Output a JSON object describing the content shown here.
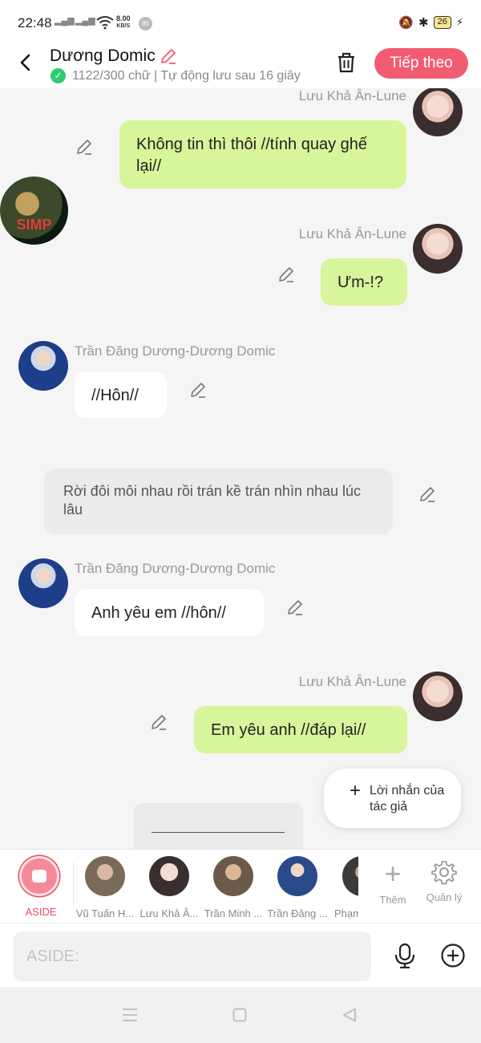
{
  "status_bar": {
    "time": "22:48",
    "net_speed_value": "8.00",
    "net_speed_unit": "KB/S",
    "notification_count": "95",
    "battery": "26"
  },
  "header": {
    "title": "Dương Domic",
    "subtitle": "1122/300 chữ | Tự động lưu sau 16 giây",
    "next_button_label": "Tiếp theo"
  },
  "messages": [
    {
      "sender": "Lưu Khả Ân-Lune",
      "text": "Không tin thì thôi //tính quay ghế lại//",
      "side": "right"
    },
    {
      "sender": "Lưu Khả Ân-Lune",
      "text": "Ưm-!?",
      "side": "right"
    },
    {
      "sender": "Trần Đăng Dương-Dương Domic",
      "text": "//Hôn//",
      "side": "left"
    },
    {
      "narration": "Rời đôi môi nhau rồi trán kề trán nhìn nhau lúc lâu"
    },
    {
      "sender": "Trần Đăng Dương-Dương Domic",
      "text": "Anh yêu em //hôn//",
      "side": "left"
    },
    {
      "sender": "Lưu Khả Ân-Lune",
      "text": "Em yêu anh //đáp lại//",
      "side": "right"
    }
  ],
  "simp_avatar_text": "SIMP",
  "author_note_label": "Lời nhắn của tác giả",
  "characters": {
    "aside_label": "ASIDE",
    "items": [
      {
        "name": "Vũ Tuấn H...",
        "color": "#7a6a5a"
      },
      {
        "name": "Lưu Khả Â...",
        "color": "#e2c2b8"
      },
      {
        "name": "Trần Minh ...",
        "color": "#6b5a4a"
      },
      {
        "name": "Trần Đăng ...",
        "color": "#2a4a8a"
      },
      {
        "name": "Phạm",
        "color": "#3a3a3a"
      }
    ],
    "add_label": "Thêm",
    "manage_label": "Quản lý"
  },
  "input": {
    "placeholder": "ASIDE:"
  },
  "colors": {
    "accent": "#f25c73",
    "my_bubble": "#d7f59a"
  }
}
